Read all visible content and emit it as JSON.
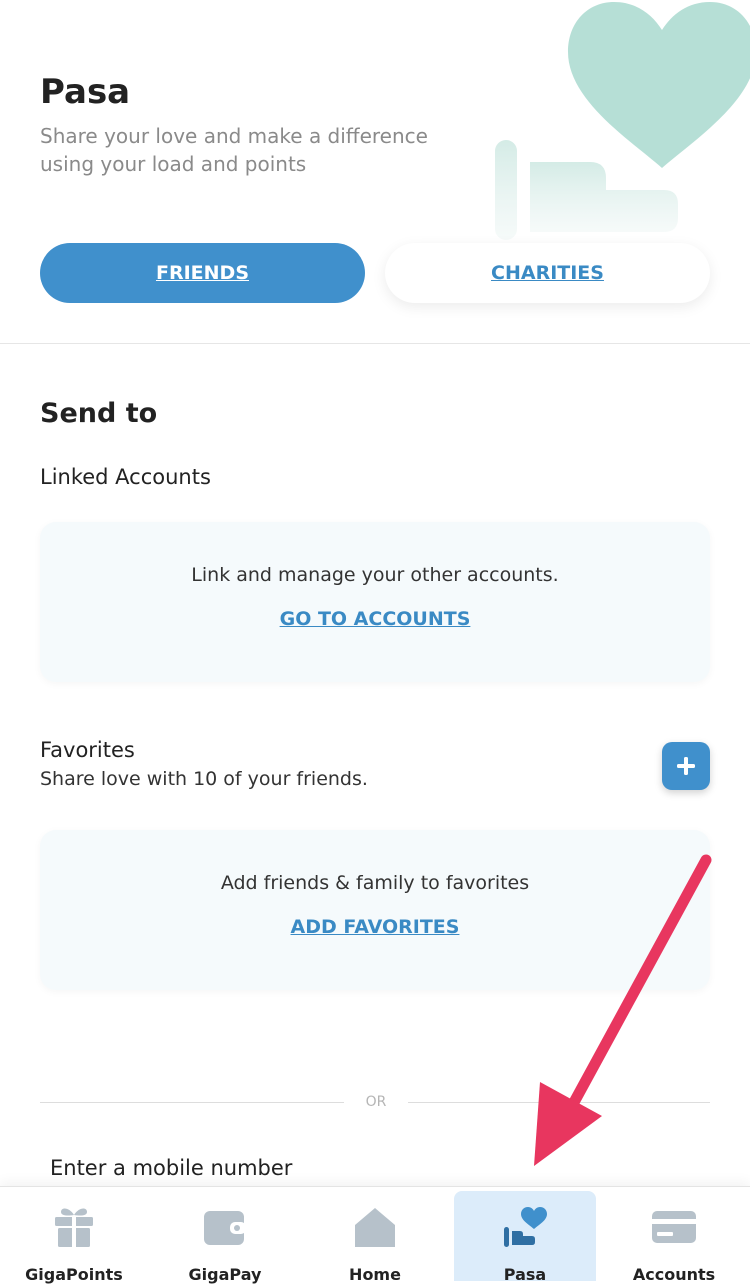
{
  "header": {
    "title": "Pasa",
    "subtitle": "Share your love and make a difference using your load and points",
    "tabs": [
      {
        "label": "FRIENDS",
        "active": true
      },
      {
        "label": "CHARITIES",
        "active": false
      }
    ]
  },
  "send_to": {
    "title": "Send to",
    "linked_accounts": {
      "title": "Linked Accounts",
      "message": "Link and manage your other accounts.",
      "link_label": "GO TO ACCOUNTS"
    },
    "favorites": {
      "title": "Favorites",
      "description": "Share love with 10 of your friends.",
      "message": "Add friends & family to favorites",
      "link_label": "ADD FAVORITES"
    },
    "divider_label": "OR",
    "mobile_label": "Enter a mobile number"
  },
  "bottom_nav": {
    "items": [
      {
        "label": "GigaPoints",
        "icon": "gift-icon",
        "active": false
      },
      {
        "label": "GigaPay",
        "icon": "wallet-icon",
        "active": false
      },
      {
        "label": "Home",
        "icon": "home-icon",
        "active": false
      },
      {
        "label": "Pasa",
        "icon": "heart-hand-icon",
        "active": true
      },
      {
        "label": "Accounts",
        "icon": "card-icon",
        "active": false
      }
    ]
  },
  "colors": {
    "accent": "#4090cc",
    "link": "#3a8ac4",
    "card_bg": "#f5fafc",
    "active_nav_bg": "#dcecfa",
    "heart_art": "#a9d9cf",
    "annotation_arrow": "#e8365f",
    "nav_icon": "#b6c1ca"
  }
}
